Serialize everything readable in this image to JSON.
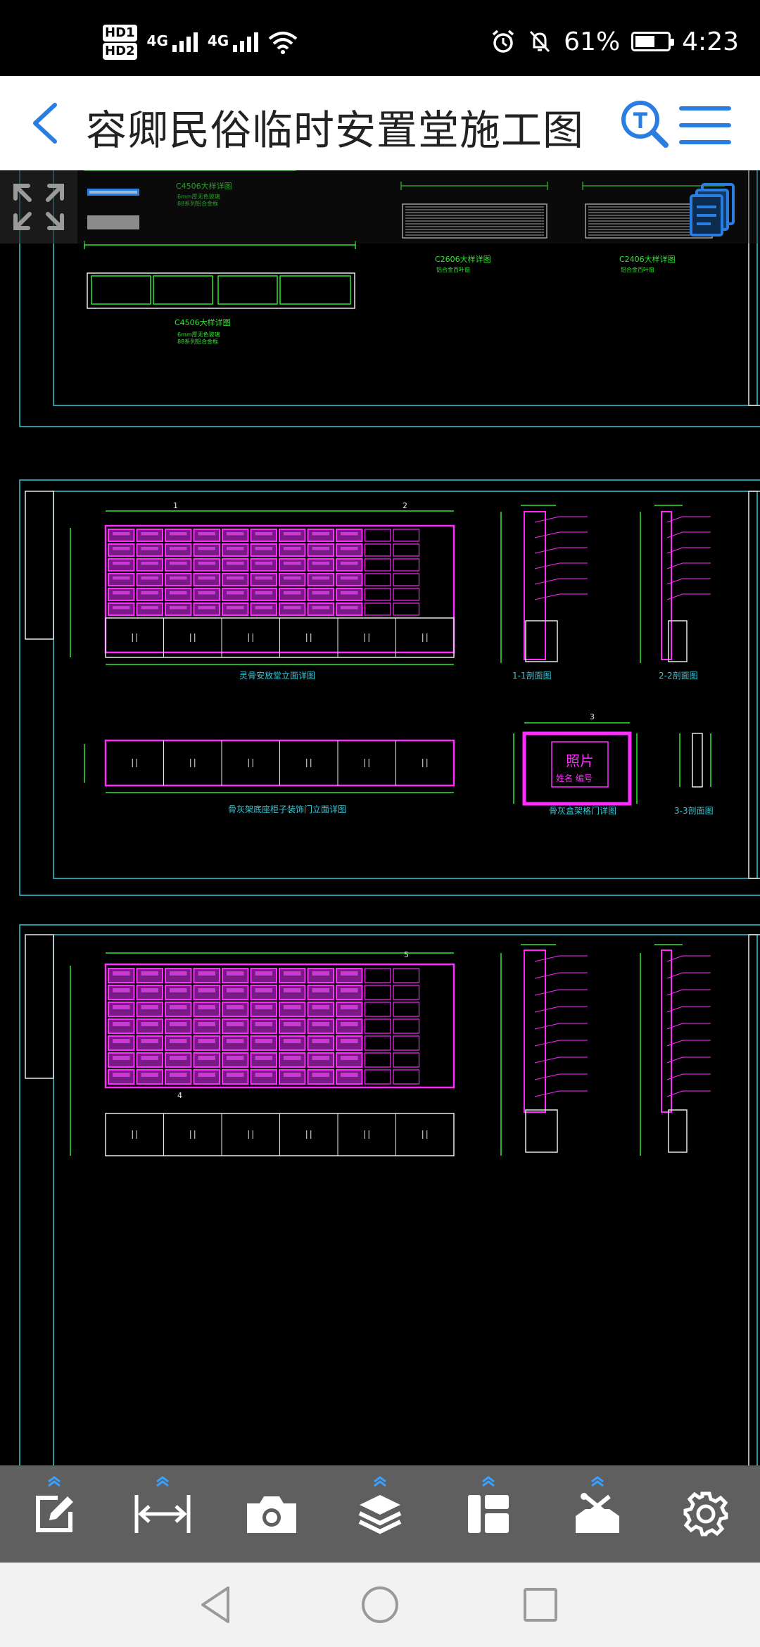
{
  "status_bar": {
    "hd1": "HD1",
    "hd2": "HD2",
    "net1": "4G",
    "net2": "4G",
    "battery_percent": "61%",
    "battery_level": 0.61,
    "time": "4:23"
  },
  "header": {
    "title": "容卿民俗临时安置堂施工图"
  },
  "icons": {
    "back": "chevron-left-icon",
    "search": "text-search-icon",
    "menu": "menu-icon",
    "fullscreen": "fullscreen-icon",
    "thumbnails": "pages-icon"
  },
  "toolbar": {
    "items": [
      "edit-icon",
      "measure-icon",
      "camera-icon",
      "layers-icon",
      "layout-icon",
      "toolbox-icon",
      "settings-icon"
    ]
  },
  "drawing_labels": {
    "c4506_top": "C4506大样详图",
    "c4506_top_note": "6mm厚无色玻璃",
    "c4506_top_note2": "88系列铝合金框",
    "c2606": "C2606大样详图",
    "c2606_note": "铝合金百叶窗",
    "c2406": "C2406大样详图",
    "c2406_note": "铝合金百叶窗",
    "c4506_bottom": "C4506大样详图",
    "c4506_bottom_note": "6mm厚无色玻璃",
    "c4506_bottom_note2": "88系列铝合金框",
    "sheet2_elev": "灵骨安放堂立面详图",
    "sec_1_1": "1-1剖面图",
    "sec_2_2": "2-2剖面图",
    "sheet2_lower": "骨灰架底座柜子装饰门立面详图",
    "niche_door": "骨灰盒架格门详图",
    "photo": "照片",
    "name_no": "姓名  编号",
    "sec_3_3": "3-3剖面图",
    "grid_a1": "1",
    "grid_a2": "2",
    "grid_b": "3",
    "grid_c4": "4",
    "grid_c5": "5"
  },
  "colors": {
    "accent": "#2a7de1",
    "cad_cyan": "#35c8d8",
    "cad_green": "#2ee82e",
    "cad_magenta": "#ff2bff",
    "cad_white": "#e8e8e8"
  }
}
